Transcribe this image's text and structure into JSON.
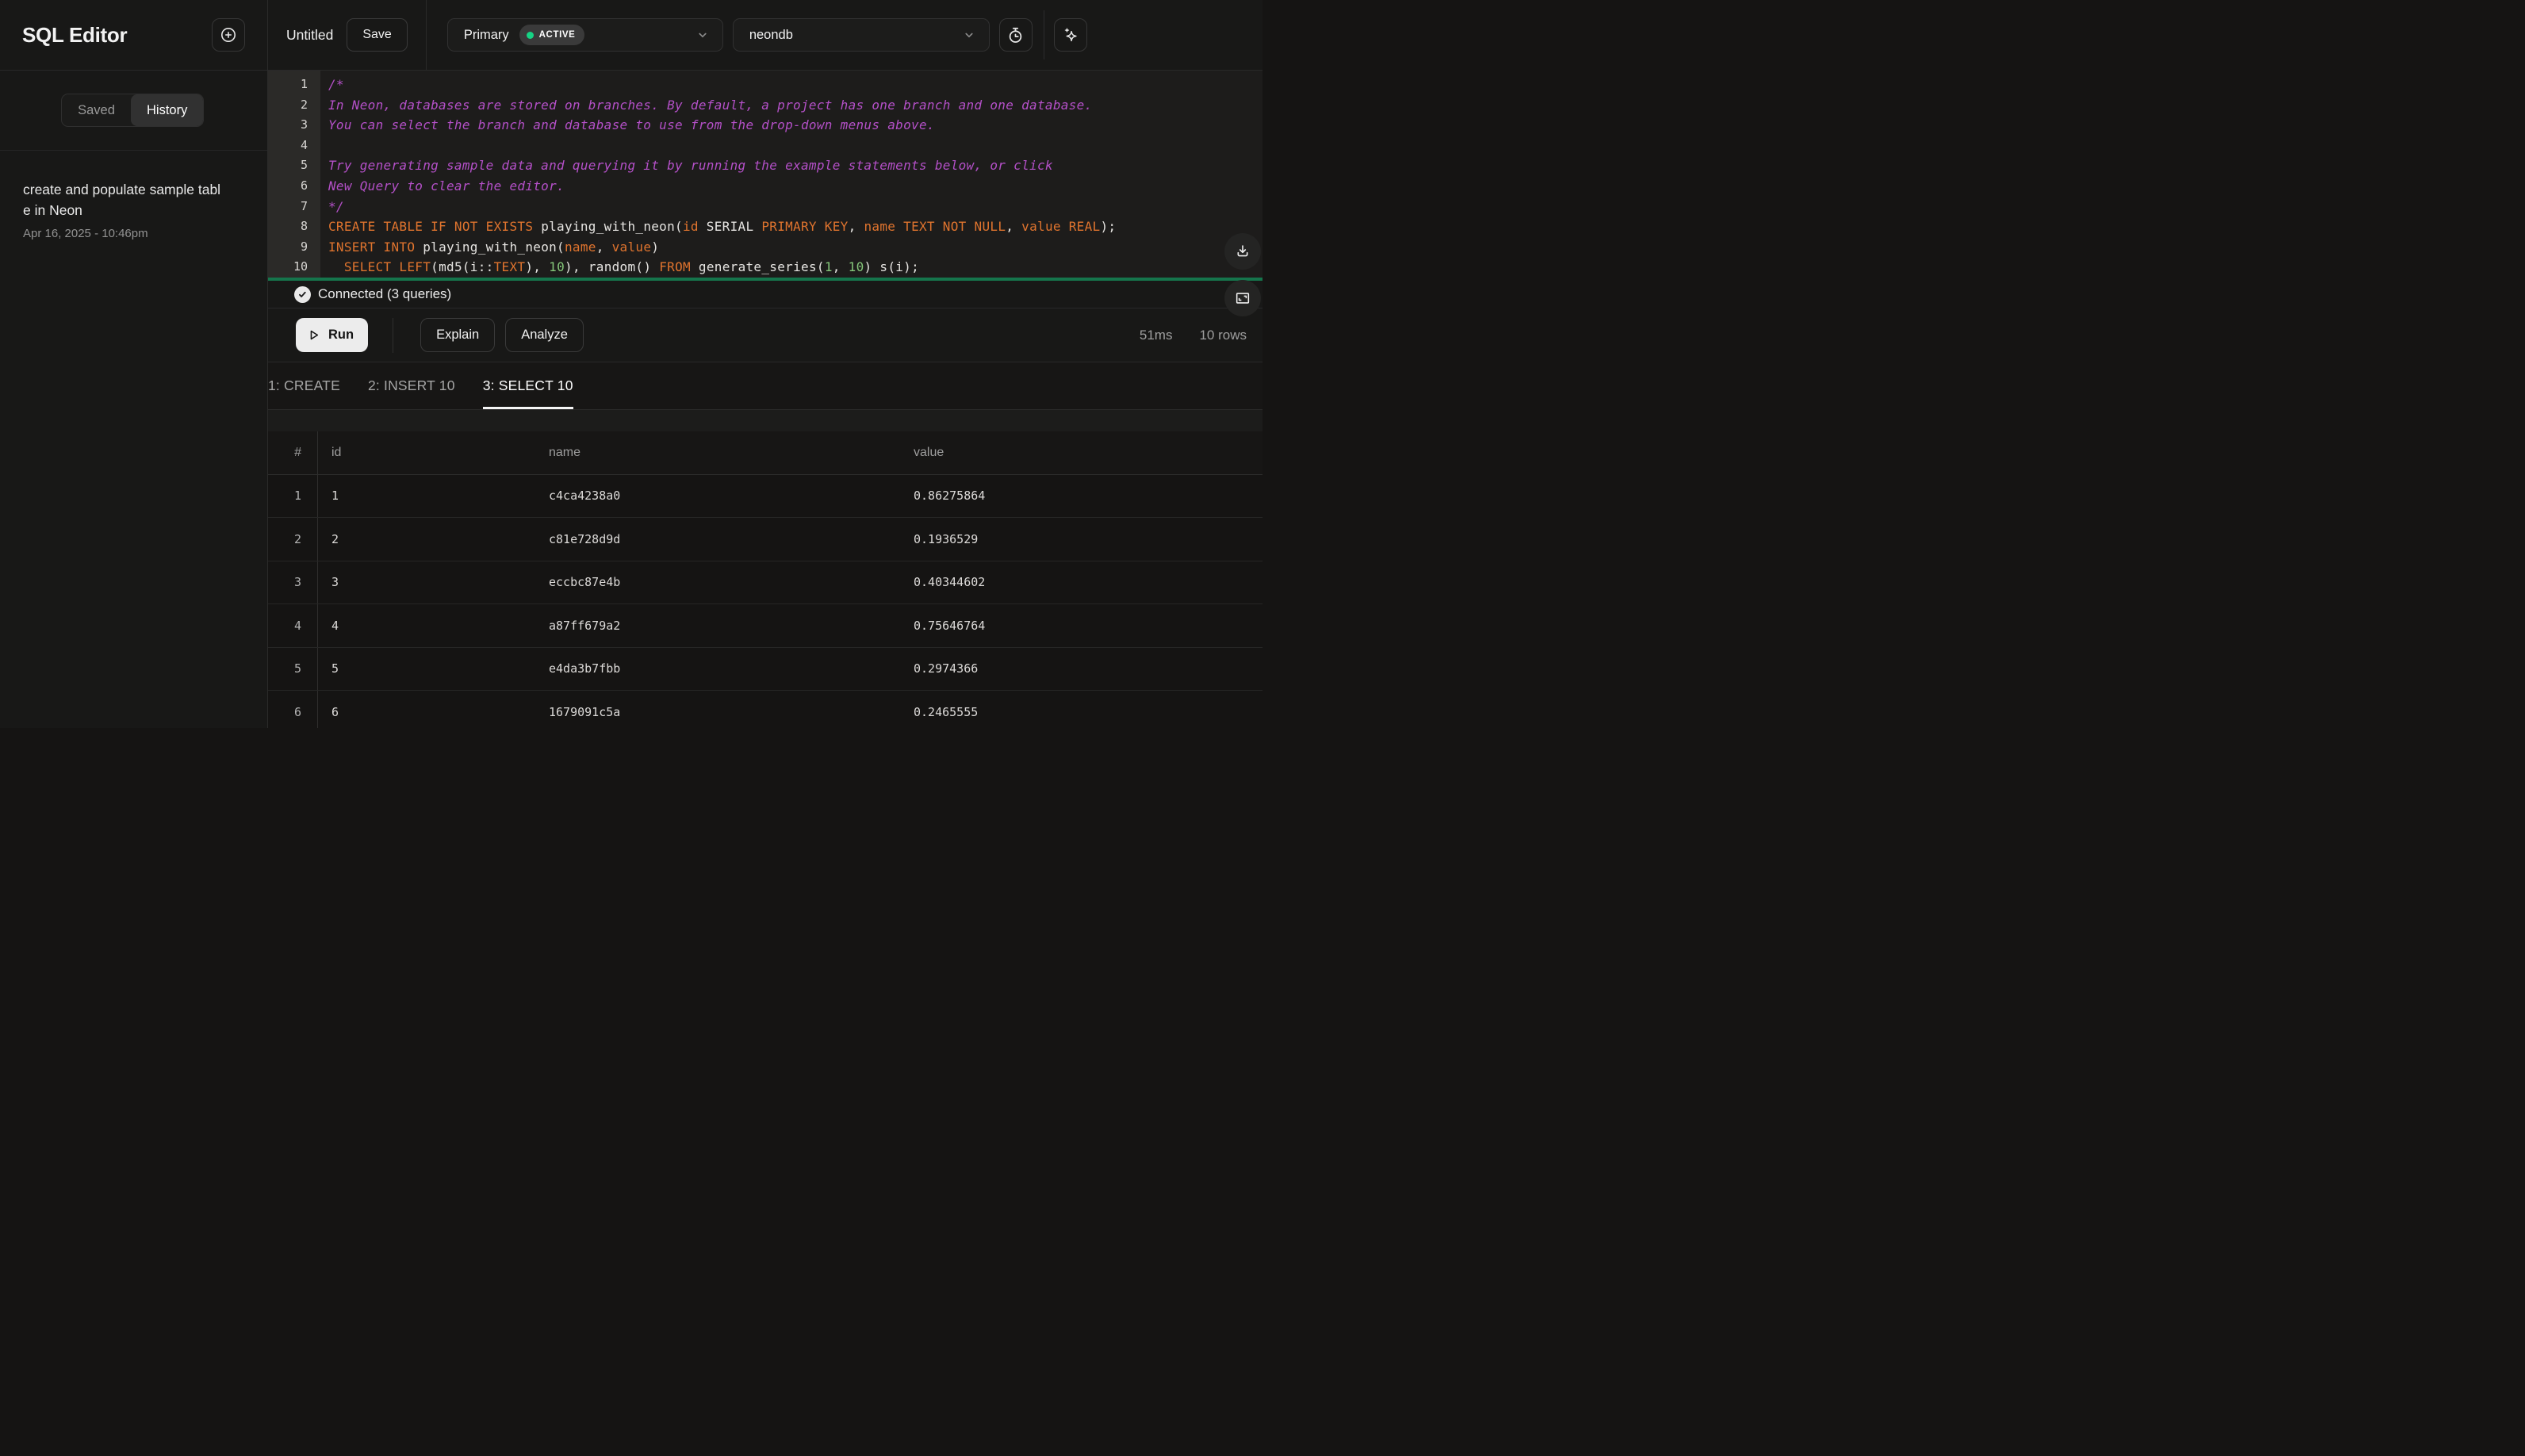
{
  "sidebar": {
    "title": "SQL Editor",
    "tabs": [
      {
        "label": "Saved",
        "active": false
      },
      {
        "label": "History",
        "active": true
      }
    ],
    "history_items": [
      {
        "title": "create and populate sample table in Neon",
        "timestamp": "Apr 16, 2025 - 10:46pm"
      }
    ]
  },
  "topbar": {
    "query_name": "Untitled",
    "save_label": "Save",
    "branch_select": {
      "value": "Primary",
      "badge": "ACTIVE"
    },
    "database_select": {
      "value": "neondb"
    }
  },
  "editor": {
    "lines": [
      {
        "no": "1",
        "segments": [
          [
            "c",
            "/*"
          ]
        ]
      },
      {
        "no": "2",
        "segments": [
          [
            "c",
            "In Neon, databases are stored on branches. By default, a project has one branch and one database."
          ]
        ]
      },
      {
        "no": "3",
        "segments": [
          [
            "c",
            "You can select the branch and database to use from the drop-down menus above."
          ]
        ]
      },
      {
        "no": "4",
        "segments": []
      },
      {
        "no": "5",
        "segments": [
          [
            "c",
            "Try generating sample data and querying it by running the example statements below, or click"
          ]
        ]
      },
      {
        "no": "6",
        "segments": [
          [
            "c",
            "New Query to clear the editor."
          ]
        ]
      },
      {
        "no": "7",
        "segments": [
          [
            "c",
            "*/"
          ]
        ]
      },
      {
        "no": "8",
        "segments": [
          [
            "k",
            "CREATE TABLE IF NOT EXISTS "
          ],
          [
            "p",
            "playing_with_neon("
          ],
          [
            "k",
            "id"
          ],
          [
            "p",
            " SERIAL "
          ],
          [
            "k",
            "PRIMARY KEY"
          ],
          [
            "p",
            ", "
          ],
          [
            "k",
            "name TEXT NOT NULL"
          ],
          [
            "p",
            ", "
          ],
          [
            "k",
            "value REAL"
          ],
          [
            "p",
            ");"
          ]
        ]
      },
      {
        "no": "9",
        "segments": [
          [
            "k",
            "INSERT INTO "
          ],
          [
            "p",
            "playing_with_neon("
          ],
          [
            "k",
            "name"
          ],
          [
            "p",
            ", "
          ],
          [
            "k",
            "value"
          ],
          [
            "p",
            ")"
          ]
        ]
      },
      {
        "no": "10",
        "segments": [
          [
            "p",
            "  "
          ],
          [
            "k",
            "SELECT LEFT"
          ],
          [
            "p",
            "(md5(i::"
          ],
          [
            "k",
            "TEXT"
          ],
          [
            "p",
            "), "
          ],
          [
            "n",
            "10"
          ],
          [
            "p",
            "), random() "
          ],
          [
            "k",
            "FROM"
          ],
          [
            "p",
            " generate_series("
          ],
          [
            "n",
            "1"
          ],
          [
            "p",
            ", "
          ],
          [
            "n",
            "10"
          ],
          [
            "p",
            ") s(i);"
          ]
        ]
      }
    ]
  },
  "status": {
    "label": "Connected (3 queries)"
  },
  "actions": {
    "run_label": "Run",
    "explain_label": "Explain",
    "analyze_label": "Analyze",
    "duration": "51ms",
    "row_count": "10 rows"
  },
  "results": {
    "tabs": [
      {
        "label": "1: CREATE",
        "active": false
      },
      {
        "label": "2: INSERT 10",
        "active": false
      },
      {
        "label": "3: SELECT 10",
        "active": true
      }
    ],
    "columns": [
      "#",
      "id",
      "name",
      "value"
    ],
    "rows": [
      [
        "1",
        "1",
        "c4ca4238a0",
        "0.86275864"
      ],
      [
        "2",
        "2",
        "c81e728d9d",
        "0.1936529"
      ],
      [
        "3",
        "3",
        "eccbc87e4b",
        "0.40344602"
      ],
      [
        "4",
        "4",
        "a87ff679a2",
        "0.75646764"
      ],
      [
        "5",
        "5",
        "e4da3b7fbb",
        "0.2974366"
      ],
      [
        "6",
        "6",
        "1679091c5a",
        "0.2465555"
      ]
    ]
  },
  "colors": {
    "editor_divider_green": "#15754c",
    "active_dot_green": "#16d384",
    "keyword_orange": "#e0742e",
    "comment_purple": "#b450c8",
    "number_green": "#85c77a"
  }
}
